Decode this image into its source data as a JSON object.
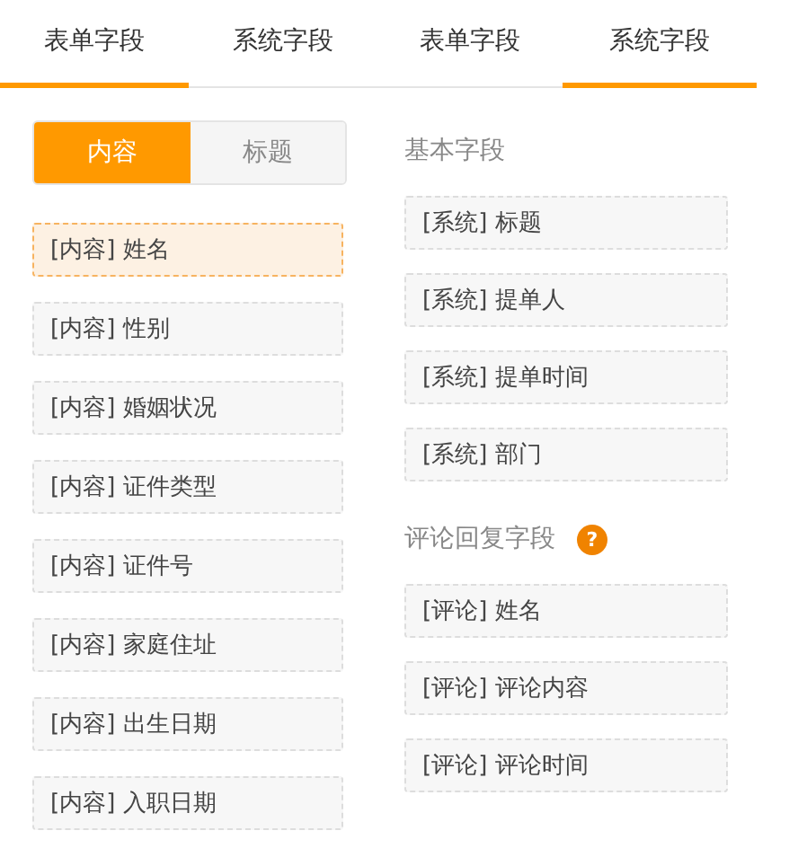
{
  "panels": [
    {
      "tabs": [
        {
          "label": "表单字段",
          "selected": true
        },
        {
          "label": "系统字段",
          "selected": false
        }
      ],
      "segments": [
        {
          "label": "内容",
          "selected": true
        },
        {
          "label": "标题",
          "selected": false
        }
      ],
      "items": [
        {
          "label": "[内容] 姓名",
          "selected": true
        },
        {
          "label": "[内容] 性别",
          "selected": false
        },
        {
          "label": "[内容] 婚姻状况",
          "selected": false
        },
        {
          "label": "[内容] 证件类型",
          "selected": false
        },
        {
          "label": "[内容] 证件号",
          "selected": false
        },
        {
          "label": "[内容] 家庭住址",
          "selected": false
        },
        {
          "label": "[内容] 出生日期",
          "selected": false
        },
        {
          "label": "[内容] 入职日期",
          "selected": false
        }
      ]
    },
    {
      "tabs": [
        {
          "label": "表单字段",
          "selected": false
        },
        {
          "label": "系统字段",
          "selected": true
        }
      ],
      "sections": [
        {
          "title": "基本字段",
          "items": [
            {
              "label": "[系统] 标题",
              "selected": false
            },
            {
              "label": "[系统] 提单人",
              "selected": false
            },
            {
              "label": "[系统] 提单时间",
              "selected": false
            },
            {
              "label": "[系统] 部门",
              "selected": false
            }
          ]
        },
        {
          "title": "评论回复字段",
          "help": "?",
          "items": [
            {
              "label": "[评论] 姓名",
              "selected": false
            },
            {
              "label": "[评论] 评论内容",
              "selected": false
            },
            {
              "label": "[评论] 评论时间",
              "selected": false
            }
          ]
        }
      ]
    }
  ]
}
